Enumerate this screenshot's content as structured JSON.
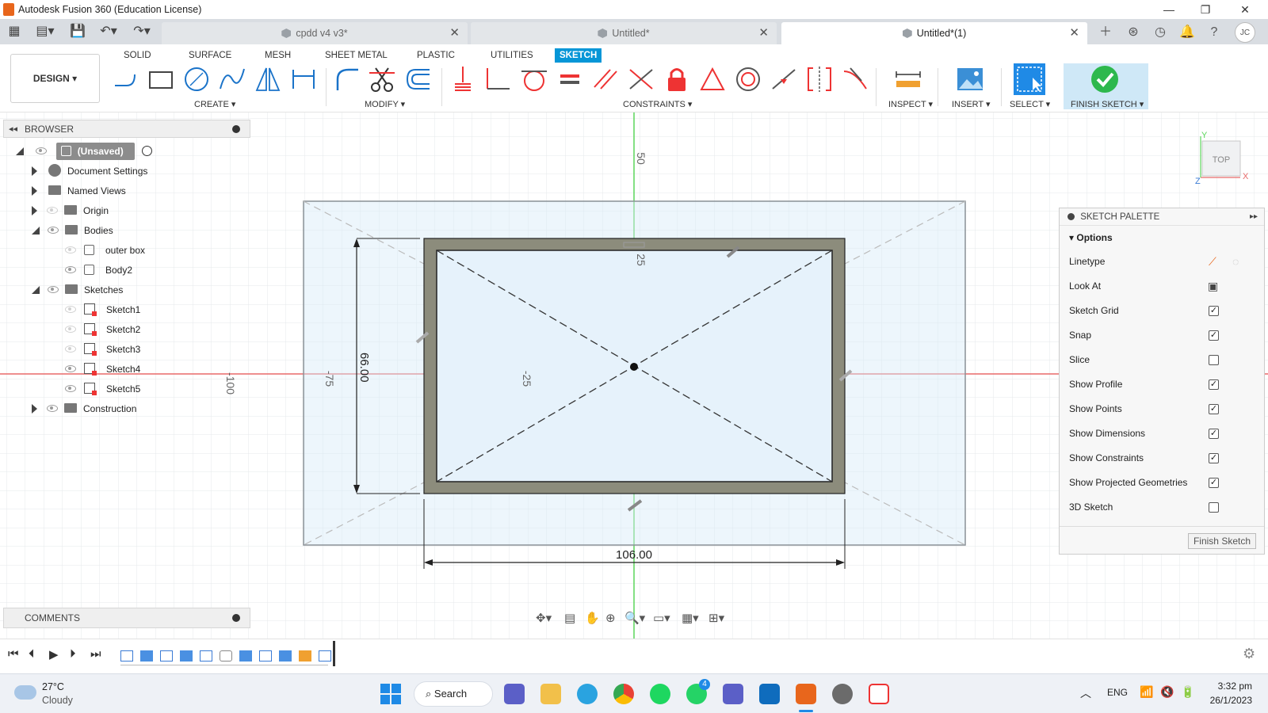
{
  "window": {
    "title": "Autodesk Fusion 360 (Education License)"
  },
  "tabs": [
    {
      "label": "cpdd v4 v3*",
      "active": false
    },
    {
      "label": "Untitled*",
      "active": false
    },
    {
      "label": "Untitled*(1)",
      "active": true
    }
  ],
  "user_initials": "JC",
  "workspace": "DESIGN",
  "ribbon_tabs": [
    "SOLID",
    "SURFACE",
    "MESH",
    "SHEET METAL",
    "PLASTIC",
    "UTILITIES",
    "SKETCH"
  ],
  "ribbon_groups": {
    "create": "CREATE",
    "modify": "MODIFY",
    "constraints": "CONSTRAINTS",
    "inspect": "INSPECT",
    "insert": "INSERT",
    "select": "SELECT",
    "finish": "FINISH SKETCH"
  },
  "browser": {
    "title": "BROWSER",
    "root": "(Unsaved)",
    "items": [
      {
        "label": "Document Settings"
      },
      {
        "label": "Named Views"
      },
      {
        "label": "Origin"
      },
      {
        "label": "Bodies"
      },
      {
        "label": "outer box"
      },
      {
        "label": "Body2"
      },
      {
        "label": "Sketches"
      },
      {
        "label": "Sketch1"
      },
      {
        "label": "Sketch2"
      },
      {
        "label": "Sketch3"
      },
      {
        "label": "Sketch4"
      },
      {
        "label": "Sketch5"
      },
      {
        "label": "Construction"
      }
    ]
  },
  "comments": {
    "title": "COMMENTS"
  },
  "canvas": {
    "ruler_top": "50",
    "ruler_inner": "25",
    "ruler_left_outer": "-100",
    "ruler_left": "-75",
    "ruler_center": "-25",
    "dim_height": "66.00",
    "dim_width": "106.00",
    "viewcube": "TOP",
    "axis_x": "X",
    "axis_y": "Y",
    "axis_z": "Z"
  },
  "palette": {
    "title": "SKETCH PALETTE",
    "section": "Options",
    "rows": [
      {
        "label": "Linetype"
      },
      {
        "label": "Look At"
      },
      {
        "label": "Sketch Grid",
        "mark": "✓"
      },
      {
        "label": "Snap",
        "mark": "✓"
      },
      {
        "label": "Slice",
        "mark": ""
      },
      {
        "label": "Show Profile",
        "mark": "✓"
      },
      {
        "label": "Show Points",
        "mark": "✓"
      },
      {
        "label": "Show Dimensions",
        "mark": "✓"
      },
      {
        "label": "Show Constraints",
        "mark": "✓"
      },
      {
        "label": "Show Projected Geometries",
        "mark": "✓"
      },
      {
        "label": "3D Sketch",
        "mark": ""
      }
    ],
    "finish_button": "Finish Sketch"
  },
  "taskbar": {
    "temp": "27°C",
    "weather": "Cloudy",
    "search": "Search",
    "lang": "ENG",
    "time": "3:32 pm",
    "date": "26/1/2023",
    "whatsapp_badge": "4"
  },
  "colors": {
    "accent": "#0696d7",
    "finish_green": "#2db84d",
    "palette_bg": "#f7f7f7"
  }
}
